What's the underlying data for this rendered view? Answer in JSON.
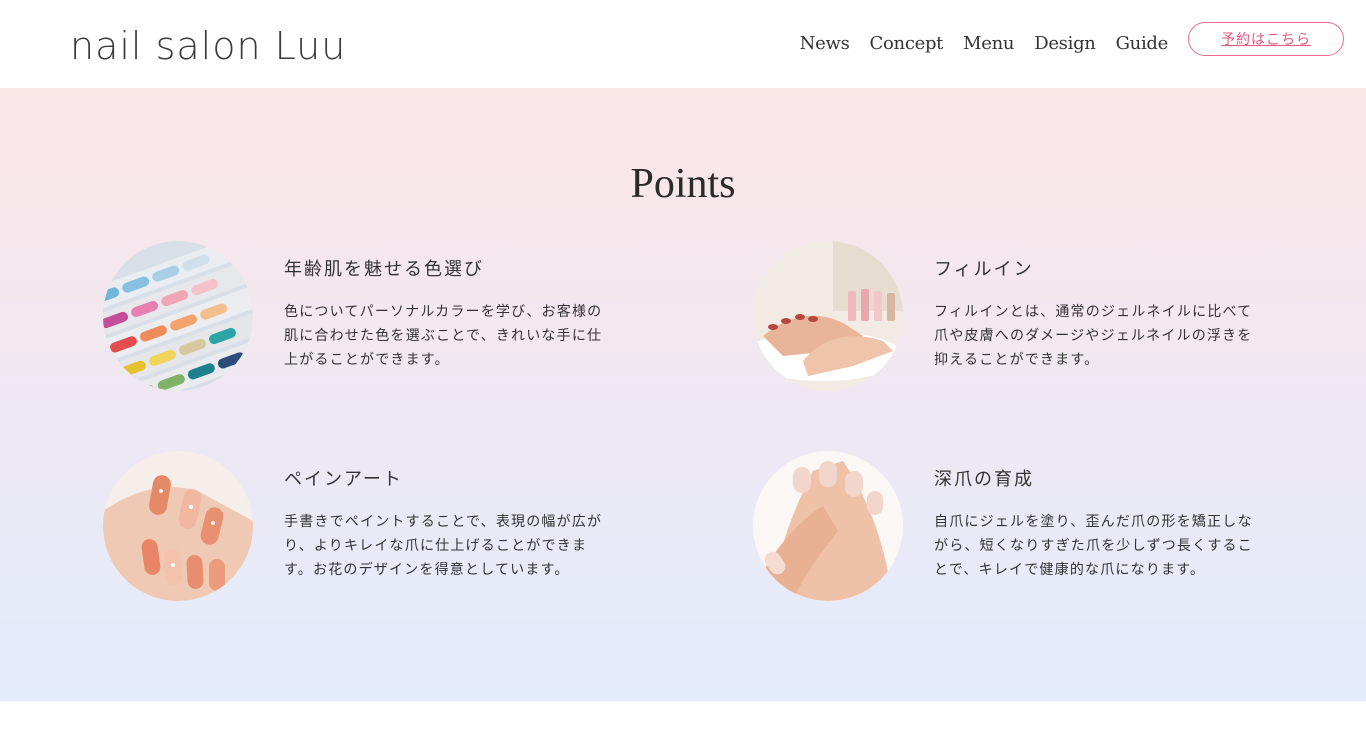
{
  "header": {
    "logo": "nail salon Luu",
    "nav": [
      "News",
      "Concept",
      "Menu",
      "Design",
      "Guide"
    ],
    "reserve_label": "予約はこちら"
  },
  "points": {
    "title": "Points",
    "items": [
      {
        "title": "年齢肌を魅せる色選び",
        "text": "色についてパーソナルカラーを学び、お客様の肌に合わせた色を選ぶことで、きれいな手に仕上がることができます。",
        "image_icon": "color-chart-photo"
      },
      {
        "title": "フィルイン",
        "text": "フィルインとは、通常のジェルネイルに比べて爪や皮膚へのダメージやジェルネイルの浮きを抑えることができます。",
        "image_icon": "nail-care-photo"
      },
      {
        "title": "ペインアート",
        "text": "手書きでペイントすることで、表現の幅が広がり、よりキレイな爪に仕上げることができます。お花のデザインを得意としています。",
        "image_icon": "glitter-nails-photo"
      },
      {
        "title": "深爪の育成",
        "text": "自爪にジェルを塗り、歪んだ爪の形を矯正しながら、短くなりすぎた爪を少しずつ長くすることで、キレイで健康的な爪になります。",
        "image_icon": "natural-nails-photo"
      }
    ]
  },
  "colors": {
    "accent": "#e8587d",
    "gradient_top": "#fbe6e7",
    "gradient_bottom": "#e2ebfc"
  }
}
